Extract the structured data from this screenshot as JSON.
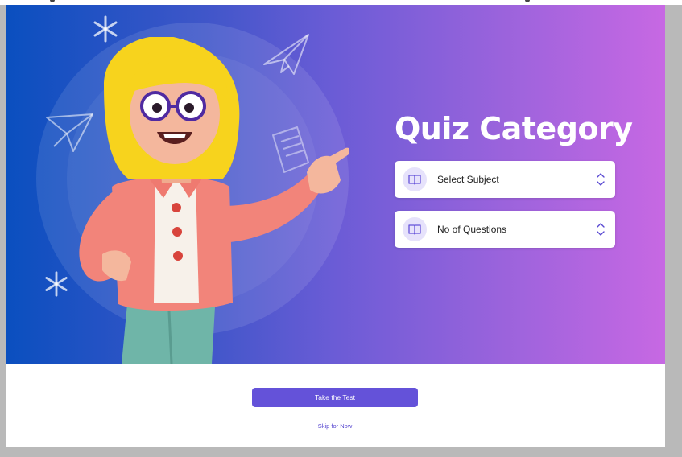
{
  "hero": {
    "title": "Quiz Category",
    "gradient": [
      "#0a4fbf",
      "#c768e3"
    ]
  },
  "form": {
    "subject_select": {
      "value": "Select Subject",
      "icon": "book-icon"
    },
    "questions_select": {
      "value": "No of Questions",
      "icon": "book-icon"
    }
  },
  "actions": {
    "primary_label": "Take the Test",
    "secondary_label": "Skip for Now"
  },
  "colors": {
    "accent": "#6452d9",
    "icon_bg": "#e6e2fb"
  }
}
